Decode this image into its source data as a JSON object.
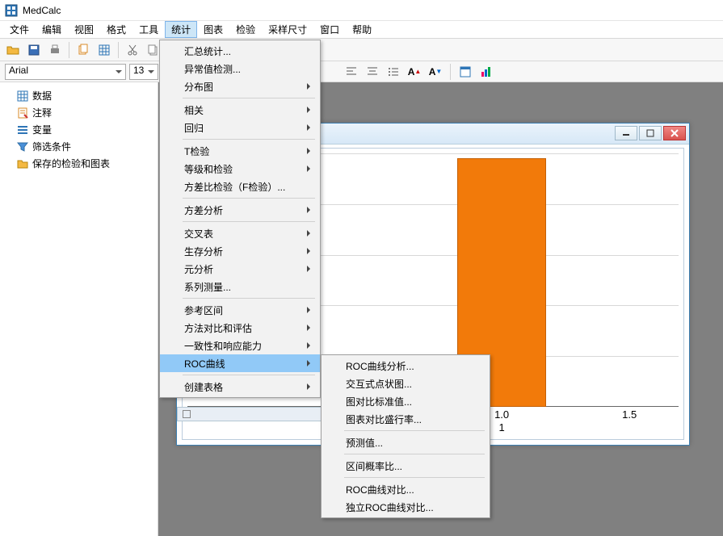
{
  "app": {
    "title": "MedCalc"
  },
  "menubar": [
    "文件",
    "编辑",
    "视图",
    "格式",
    "工具",
    "统计",
    "图表",
    "检验",
    "采样尺寸",
    "窗口",
    "帮助"
  ],
  "active_menu_index": 5,
  "font": {
    "name": "Arial",
    "size": "13"
  },
  "sidebar": {
    "items": [
      {
        "icon": "grid-icon",
        "label": "数据"
      },
      {
        "icon": "note-icon",
        "label": "注释"
      },
      {
        "icon": "var-icon",
        "label": "变量"
      },
      {
        "icon": "filter-icon",
        "label": "筛选条件"
      },
      {
        "icon": "folder-icon",
        "label": "保存的检验和图表"
      }
    ]
  },
  "stats_menu": [
    {
      "label": "汇总统计...",
      "sub": false
    },
    {
      "label": "异常值检测...",
      "sub": false
    },
    {
      "label": "分布图",
      "sub": true
    },
    {
      "sep": true
    },
    {
      "label": "相关",
      "sub": true
    },
    {
      "label": "回归",
      "sub": true
    },
    {
      "sep": true
    },
    {
      "label": "T检验",
      "sub": true
    },
    {
      "label": "等级和检验",
      "sub": true
    },
    {
      "label": "方差比检验（F检验）...",
      "sub": false
    },
    {
      "sep": true
    },
    {
      "label": "方差分析",
      "sub": true
    },
    {
      "sep": true
    },
    {
      "label": "交叉表",
      "sub": true
    },
    {
      "label": "生存分析",
      "sub": true
    },
    {
      "label": "元分析",
      "sub": true
    },
    {
      "label": "系列测量...",
      "sub": false
    },
    {
      "sep": true
    },
    {
      "label": "参考区间",
      "sub": true
    },
    {
      "label": "方法对比和评估",
      "sub": true
    },
    {
      "label": "一致性和响应能力",
      "sub": true
    },
    {
      "label": "ROC曲线",
      "sub": true,
      "highlight": true
    },
    {
      "sep": true
    },
    {
      "label": "创建表格",
      "sub": true
    }
  ],
  "roc_submenu": [
    {
      "label": "ROC曲线分析..."
    },
    {
      "label": "交互式点状图..."
    },
    {
      "label": "图对比标准值..."
    },
    {
      "label": "图表对比盛行率..."
    },
    {
      "sep": true
    },
    {
      "label": "预测值..."
    },
    {
      "sep": true
    },
    {
      "label": "区间概率比..."
    },
    {
      "sep": true
    },
    {
      "label": "ROC曲线对比..."
    },
    {
      "label": "独立ROC曲线对比..."
    }
  ],
  "chart_data": {
    "type": "bar",
    "categories": [
      "1"
    ],
    "values": [
      1.0
    ],
    "xticks": [
      "1.0",
      "1.5"
    ],
    "xsub": "1",
    "ylim": [
      0,
      1.0
    ]
  }
}
